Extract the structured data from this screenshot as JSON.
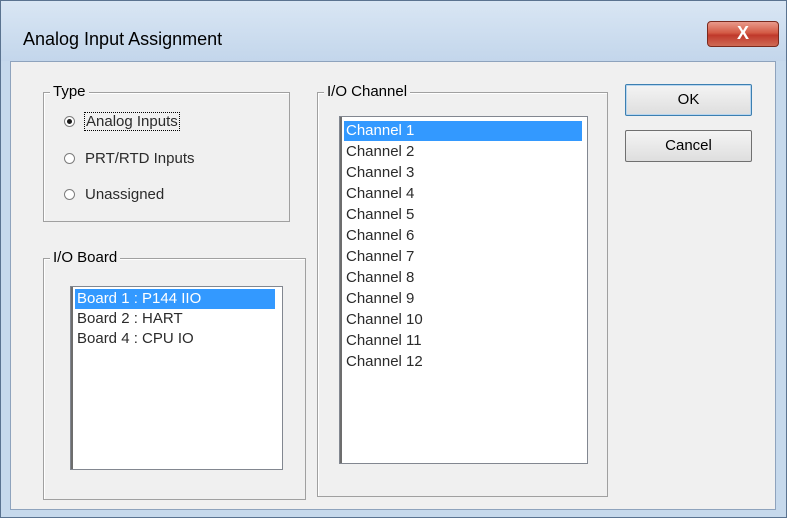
{
  "window": {
    "title": "Analog Input Assignment",
    "close_glyph": "X"
  },
  "type_group": {
    "legend": "Type",
    "options": [
      {
        "label": "Analog Inputs",
        "checked": true
      },
      {
        "label": "PRT/RTD Inputs",
        "checked": false
      },
      {
        "label": "Unassigned",
        "checked": false
      }
    ]
  },
  "io_board": {
    "legend": "I/O Board",
    "items": [
      {
        "label": "Board 1 : P144 IIO",
        "selected": true
      },
      {
        "label": "Board 2 : HART",
        "selected": false
      },
      {
        "label": "Board 4 : CPU IO",
        "selected": false
      }
    ]
  },
  "io_channel": {
    "legend": "I/O Channel",
    "items": [
      {
        "label": "Channel 1",
        "selected": true
      },
      {
        "label": "Channel 2",
        "selected": false
      },
      {
        "label": "Channel 3",
        "selected": false
      },
      {
        "label": "Channel 4",
        "selected": false
      },
      {
        "label": "Channel 5",
        "selected": false
      },
      {
        "label": "Channel 6",
        "selected": false
      },
      {
        "label": "Channel 7",
        "selected": false
      },
      {
        "label": "Channel 8",
        "selected": false
      },
      {
        "label": "Channel 9",
        "selected": false
      },
      {
        "label": "Channel 10",
        "selected": false
      },
      {
        "label": "Channel 11",
        "selected": false
      },
      {
        "label": "Channel 12",
        "selected": false
      }
    ]
  },
  "buttons": {
    "ok": "OK",
    "cancel": "Cancel"
  },
  "colors": {
    "selection": "#3399ff",
    "close_button": "#c0392b",
    "title_bar": "#c6d9ec"
  }
}
